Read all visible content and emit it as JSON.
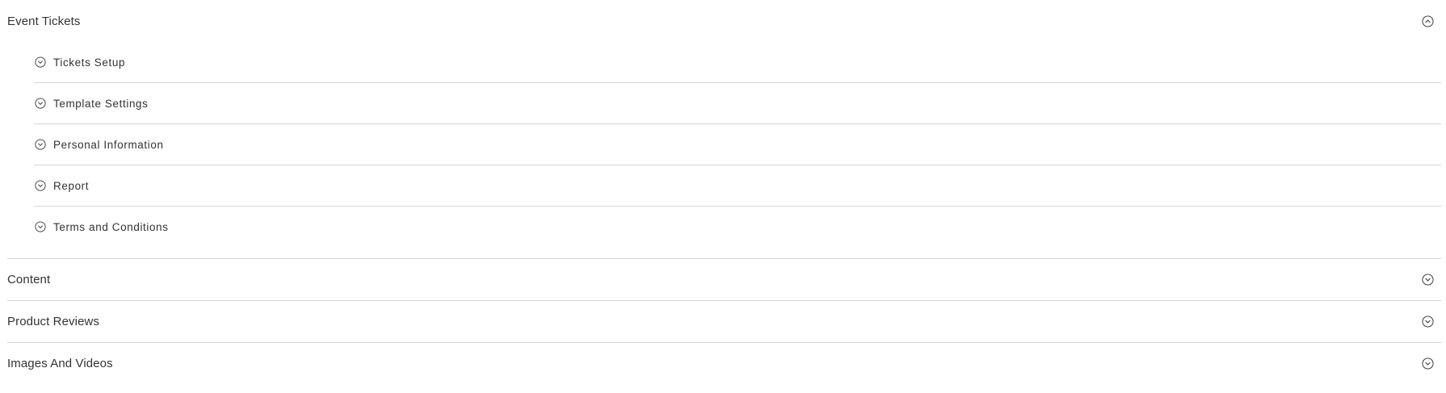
{
  "sections": [
    {
      "title": "Event Tickets",
      "state": "expanded",
      "toggle_icon": "chevron-up-circle-icon",
      "subsections": [
        {
          "label": "Tickets Setup",
          "icon": "chevron-down-circle-icon"
        },
        {
          "label": "Template Settings",
          "icon": "chevron-down-circle-icon"
        },
        {
          "label": "Personal Information",
          "icon": "chevron-down-circle-icon"
        },
        {
          "label": "Report",
          "icon": "chevron-down-circle-icon"
        },
        {
          "label": "Terms and Conditions",
          "icon": "chevron-down-circle-icon"
        }
      ]
    },
    {
      "title": "Content",
      "state": "collapsed",
      "toggle_icon": "chevron-down-circle-icon"
    },
    {
      "title": "Product Reviews",
      "state": "collapsed",
      "toggle_icon": "chevron-down-circle-icon"
    },
    {
      "title": "Images And Videos",
      "state": "collapsed",
      "toggle_icon": "chevron-down-circle-icon"
    }
  ],
  "colors": {
    "text": "#333333",
    "divider": "#d6d6d6",
    "icon": "#333333",
    "background": "#ffffff"
  }
}
